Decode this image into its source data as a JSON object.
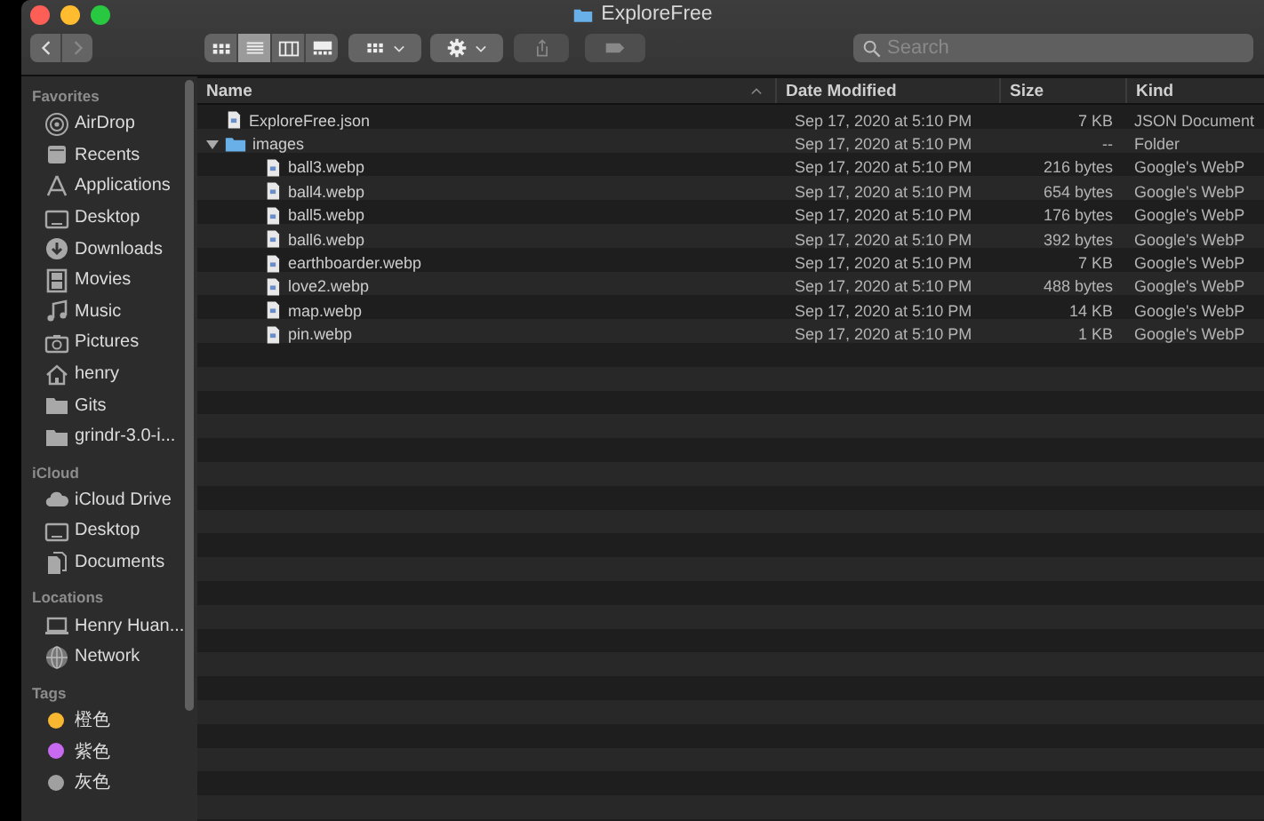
{
  "window": {
    "title": "ExploreFree"
  },
  "toolbar": {
    "views": [
      {
        "selected": false
      },
      {
        "selected": true
      },
      {
        "selected": false
      },
      {
        "selected": false
      }
    ],
    "search": {
      "placeholder": "Search"
    }
  },
  "sidebar": {
    "sections": [
      {
        "title": "Favorites",
        "items": [
          {
            "label": "AirDrop"
          },
          {
            "label": "Recents"
          },
          {
            "label": "Applications"
          },
          {
            "label": "Desktop"
          },
          {
            "label": "Downloads"
          },
          {
            "label": "Movies"
          },
          {
            "label": "Music"
          },
          {
            "label": "Pictures"
          },
          {
            "label": "henry"
          },
          {
            "label": "Gits"
          },
          {
            "label": "grindr-3.0-i..."
          }
        ]
      },
      {
        "title": "iCloud",
        "items": [
          {
            "label": "iCloud Drive"
          },
          {
            "label": "Desktop"
          },
          {
            "label": "Documents"
          }
        ]
      },
      {
        "title": "Locations",
        "items": [
          {
            "label": "Henry Huan..."
          },
          {
            "label": "Network"
          }
        ]
      },
      {
        "title": "Tags",
        "items": [
          {
            "label": "橙色",
            "color": "#f7b731"
          },
          {
            "label": "紫色",
            "color": "#c86af0"
          },
          {
            "label": "灰色",
            "color": "#a0a0a0"
          }
        ]
      }
    ]
  },
  "table": {
    "columns": [
      "Name",
      "Date Modified",
      "Size",
      "Kind"
    ],
    "rows": [
      {
        "kind": "file",
        "name": "ExploreFree.json",
        "date": "Sep 17, 2020 at 5:10 PM",
        "size": "7 KB",
        "type": "JSON Document"
      },
      {
        "kind": "folder",
        "name": "images",
        "expanded": true,
        "date": "Sep 17, 2020 at 5:10 PM",
        "size": "--",
        "type": "Folder",
        "children": [
          {
            "kind": "file",
            "name": "ball3.webp",
            "date": "Sep 17, 2020 at 5:10 PM",
            "size": "216 bytes",
            "type": "Google's WebP"
          },
          {
            "kind": "file",
            "name": "ball4.webp",
            "date": "Sep 17, 2020 at 5:10 PM",
            "size": "654 bytes",
            "type": "Google's WebP"
          },
          {
            "kind": "file",
            "name": "ball5.webp",
            "date": "Sep 17, 2020 at 5:10 PM",
            "size": "176 bytes",
            "type": "Google's WebP"
          },
          {
            "kind": "file",
            "name": "ball6.webp",
            "date": "Sep 17, 2020 at 5:10 PM",
            "size": "392 bytes",
            "type": "Google's WebP"
          },
          {
            "kind": "file",
            "name": "earthboarder.webp",
            "date": "Sep 17, 2020 at 5:10 PM",
            "size": "7 KB",
            "type": "Google's WebP"
          },
          {
            "kind": "file",
            "name": "love2.webp",
            "date": "Sep 17, 2020 at 5:10 PM",
            "size": "488 bytes",
            "type": "Google's WebP"
          },
          {
            "kind": "file",
            "name": "map.webp",
            "date": "Sep 17, 2020 at 5:10 PM",
            "size": "14 KB",
            "type": "Google's WebP"
          },
          {
            "kind": "file",
            "name": "pin.webp",
            "date": "Sep 17, 2020 at 5:10 PM",
            "size": "1 KB",
            "type": "Google's WebP"
          }
        ]
      }
    ]
  }
}
